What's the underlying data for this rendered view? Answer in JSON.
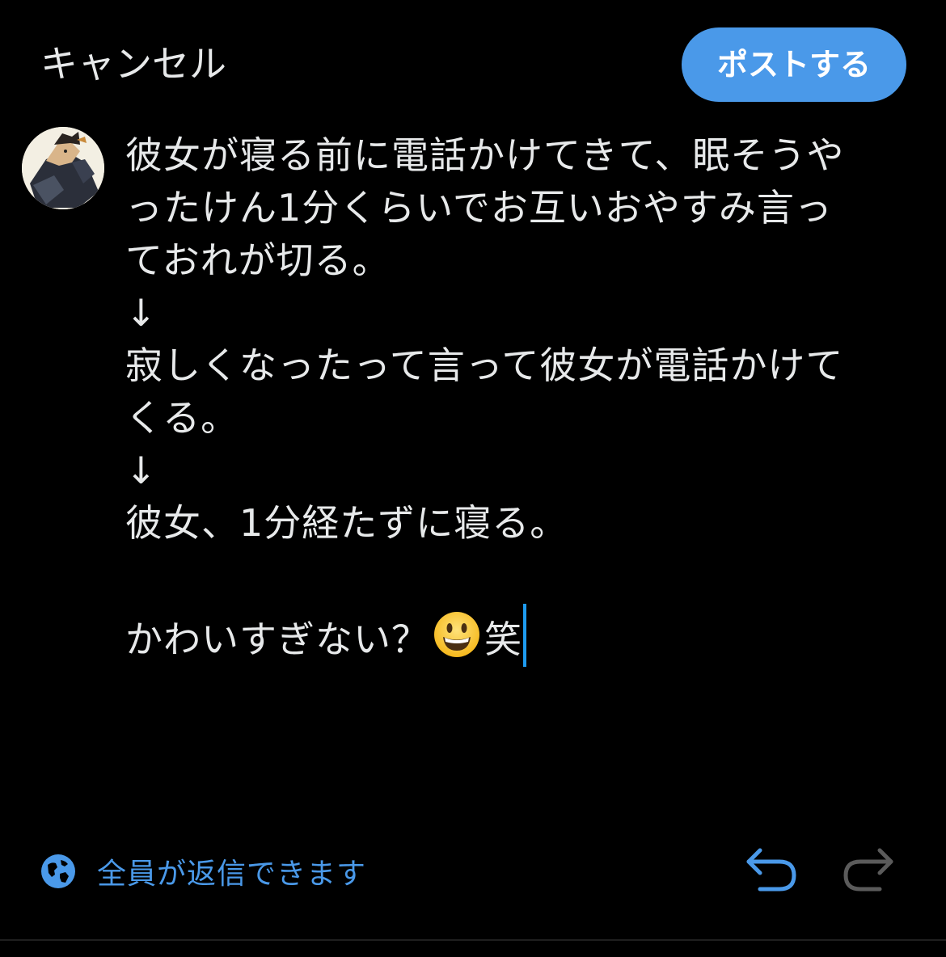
{
  "header": {
    "cancel_label": "キャンセル",
    "post_label": "ポストする"
  },
  "composer": {
    "lines": [
      "彼女が寝る前に電話かけてきて、眠そうや",
      "ったけん1分くらいでお互いおやすみ言っ",
      "ておれが切る。",
      "↓",
      "寂しくなったって言って彼女が電話かけて",
      "くる。",
      "↓",
      "彼女、1分経たずに寝る。",
      "",
      "かわいすぎない？"
    ],
    "last_line_suffix": "笑",
    "emoji": "grinning-face-emoji"
  },
  "footer": {
    "reply_setting_label": "全員が返信できます",
    "reply_icon": "globe-icon",
    "undo_icon": "undo-icon",
    "redo_icon": "redo-icon"
  },
  "colors": {
    "background": "#000000",
    "text": "#e7e9ea",
    "accent": "#4a99e9",
    "caret": "#1d9bf0",
    "disabled_icon": "#5b5b5b"
  }
}
